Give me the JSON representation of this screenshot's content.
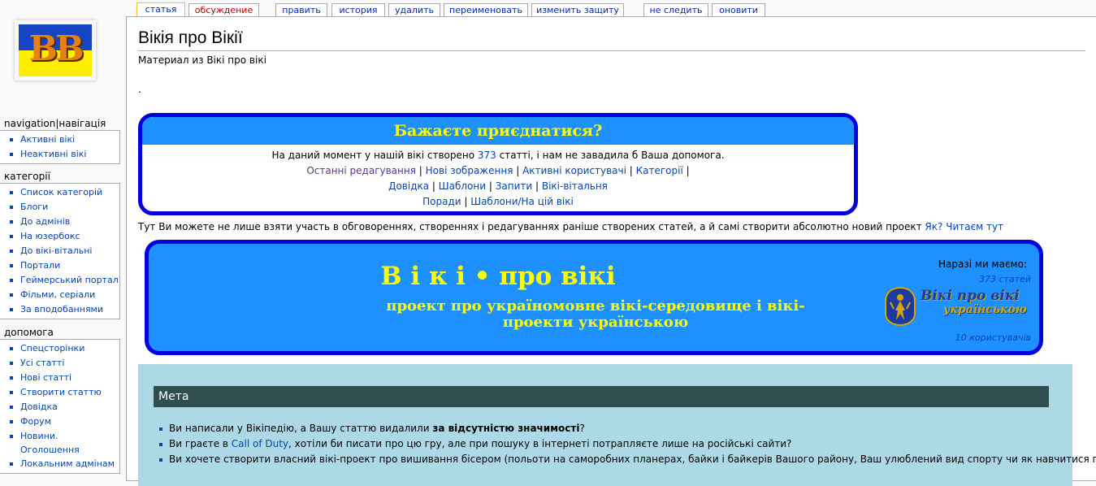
{
  "tabs": [
    {
      "label": "статья",
      "selected": true
    },
    {
      "label": "обсуждение",
      "new": true
    },
    {
      "label": "править"
    },
    {
      "label": "история"
    },
    {
      "label": "удалить"
    },
    {
      "label": "переименовать"
    },
    {
      "label": "изменить защиту"
    },
    {
      "label": "не следить"
    },
    {
      "label": "оновити"
    }
  ],
  "logo": {
    "text": "BB"
  },
  "sidebar": {
    "navigation": {
      "title": "navigation|навігація",
      "items": [
        "Активні вікі",
        "Неактивні вікі"
      ]
    },
    "categories": {
      "title": "категорії",
      "items": [
        "Список категорій",
        "Блоги",
        "До адмінів",
        "На юзербокс",
        "До вікі-вітальні",
        "Портали",
        "Геймерський портал",
        "Фільми, серіали",
        "За вподобаннями"
      ]
    },
    "help": {
      "title": "допомога",
      "items": [
        "Спецсторінки",
        "Усі статті",
        "Нові статті",
        "Створити статтю",
        "Довідка",
        "Форум",
        "Новини. Оголошення",
        "Локальним адмінам"
      ]
    }
  },
  "page": {
    "title": "Вікія про Вікії",
    "sitesub": "Материал из Вікі про вікі",
    "dot": "."
  },
  "join": {
    "heading": "Бажаєте приєднатися?",
    "text_before": "На даний момент у нашій вікі створено ",
    "count": "373",
    "text_after": " статті, і нам не завадила б Ваша допомога.",
    "links1": [
      "Останні редагування",
      "Нові зображення",
      "Активні користувачі",
      "Категорії"
    ],
    "links2": [
      "Довідка",
      "Шаблони",
      "Запити",
      "Вікі-вітальня"
    ],
    "links3": [
      "Поради",
      "Шаблони/На цій вікі"
    ]
  },
  "intro": {
    "text": "Тут Ви можете не лише взяти участь в обговореннях, створеннях і редагуваннях раніше створених статей, а й самі створити абсолютно новий проект ",
    "link1": "Як?",
    "link2": "Читаєм тут"
  },
  "banner": {
    "title": "В і к і • про вікі",
    "subtitle": "проект про україномовне вікі-середовище і вікі-проекти українською",
    "have": "Наразі ми маємо:",
    "articles": "373 статей",
    "users": "10 користувачів",
    "logo_line1": "Вікі про вікі",
    "logo_line2": "українською"
  },
  "meta": {
    "heading": "Мета",
    "items": [
      {
        "a": "Ви написали у Вікіпедію, а Вашу статтю видалили ",
        "b": "за відсутністю значимості",
        "c": "?"
      },
      {
        "a": "Ви граєте в ",
        "link": "Call of Duty",
        "c": ", хотіли би писати про цю гру, але при пошуку в інтернеті потрапляєте лише на російські сайти?"
      },
      {
        "a": "Ви хочете створити власний вікі-проект про вишивання бісером (польоти на саморобних планерах, байки і байкерів Вашого району, Ваш улюблений вид спорту чи як навчитися грати"
      }
    ]
  }
}
